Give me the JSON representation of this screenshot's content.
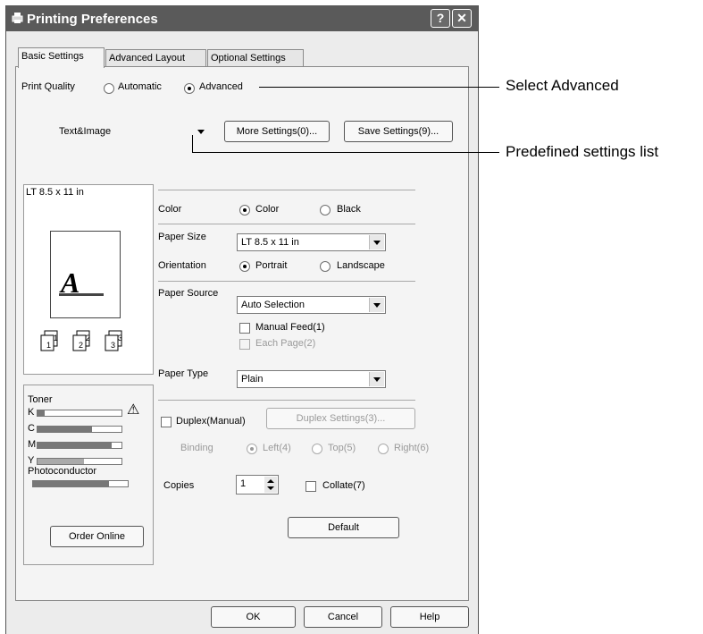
{
  "window": {
    "title": "Printing Preferences",
    "help_label": "?",
    "close_label": "✕"
  },
  "tabs": [
    {
      "label": "Basic Settings"
    },
    {
      "label": "Advanced Layout"
    },
    {
      "label": "Optional Settings"
    }
  ],
  "print_quality": {
    "label": "Print Quality",
    "options": [
      "Automatic",
      "Advanced"
    ],
    "selected": "Advanced"
  },
  "predefined": {
    "value": "Text&Image"
  },
  "buttons": {
    "more_settings": "More Settings(0)...",
    "save_settings": "Save Settings(9)...",
    "duplex_settings": "Duplex Settings(3)...",
    "default": "Default",
    "ok": "OK",
    "cancel": "Cancel",
    "help": "Help",
    "order_online": "Order Online"
  },
  "preview": {
    "paper": "LT 8.5 x 11 in",
    "glyph": "A",
    "copies_icons": [
      "1",
      "2",
      "3"
    ]
  },
  "color": {
    "label": "Color",
    "options": [
      "Color",
      "Black"
    ],
    "selected": "Color"
  },
  "paper_size": {
    "label": "Paper Size",
    "value": "LT 8.5 x 11 in"
  },
  "orientation": {
    "label": "Orientation",
    "options": [
      "Portrait",
      "Landscape"
    ],
    "selected": "Portrait"
  },
  "paper_source": {
    "label": "Paper Source",
    "value": "Auto Selection",
    "manual_feed": "Manual Feed(1)",
    "each_page": "Each Page(2)"
  },
  "paper_type": {
    "label": "Paper Type",
    "value": "Plain"
  },
  "duplex": {
    "label": "Duplex(Manual)",
    "binding_label": "Binding",
    "binding_options": [
      "Left(4)",
      "Top(5)",
      "Right(6)"
    ],
    "binding_selected": "Left(4)"
  },
  "copies": {
    "label": "Copies",
    "value": "1",
    "collate": "Collate(7)"
  },
  "toner": {
    "label": "Toner",
    "warning_glyph": "⚠",
    "levels": [
      {
        "name": "K",
        "level": 0.08
      },
      {
        "name": "C",
        "level": 0.65
      },
      {
        "name": "M",
        "level": 0.88
      },
      {
        "name": "Y",
        "level": 0.55
      }
    ],
    "photoconductor_label": "Photoconductor",
    "photoconductor_level": 0.8
  },
  "callouts": {
    "advanced": "Select Advanced",
    "predefined": "Predefined settings list"
  },
  "colors": {
    "titlebar": "#5a5a5a",
    "window": "#ececec",
    "panel": "#f4f4f4"
  }
}
